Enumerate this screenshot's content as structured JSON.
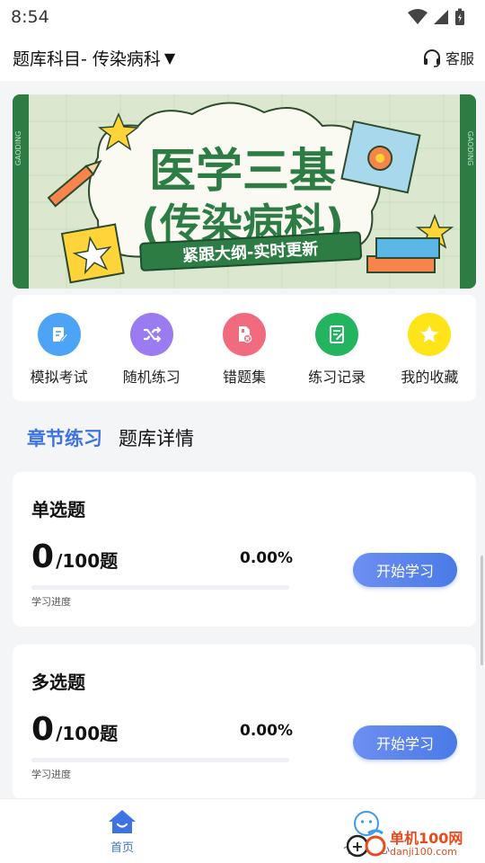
{
  "status_bar": {
    "time": "8:54"
  },
  "header": {
    "subject_label": "题库科目- 传染病科",
    "caret": "▼",
    "service_label": "客服"
  },
  "banner": {
    "title_line1": "医学三基",
    "title_line2": "(传染病科)",
    "slogan": "紧跟大纲-实时更新",
    "side_mark": "GAODING"
  },
  "menu": [
    {
      "label": "模拟考试",
      "icon": "exam-icon",
      "color": "#4da3f5"
    },
    {
      "label": "随机练习",
      "icon": "shuffle-icon",
      "color": "#9a7cf0"
    },
    {
      "label": "错题集",
      "icon": "wrong-questions-icon",
      "color": "#f06b7d"
    },
    {
      "label": "练习记录",
      "icon": "record-icon",
      "color": "#22b45e"
    },
    {
      "label": "我的收藏",
      "icon": "star-icon",
      "color": "#ffd21f"
    }
  ],
  "tabs": {
    "active": "章节练习",
    "other": "题库详情"
  },
  "question_types": [
    {
      "title": "单选题",
      "done": "0",
      "total": "/100题",
      "percent": "0.00%",
      "progress": 0,
      "progress_label": "学习进度",
      "button": "开始学习"
    },
    {
      "title": "多选题",
      "done": "0",
      "total": "/100题",
      "percent": "0.00%",
      "progress": 0,
      "progress_label": "学习进度",
      "button": "开始学习"
    }
  ],
  "bottom_nav": {
    "home": "首页",
    "me": "个人中心"
  },
  "watermark": {
    "line1": "单机100网",
    "line2": "danji100.com"
  },
  "colors": {
    "accent": "#3d73e3",
    "banner_green": "#1f7a3a"
  }
}
